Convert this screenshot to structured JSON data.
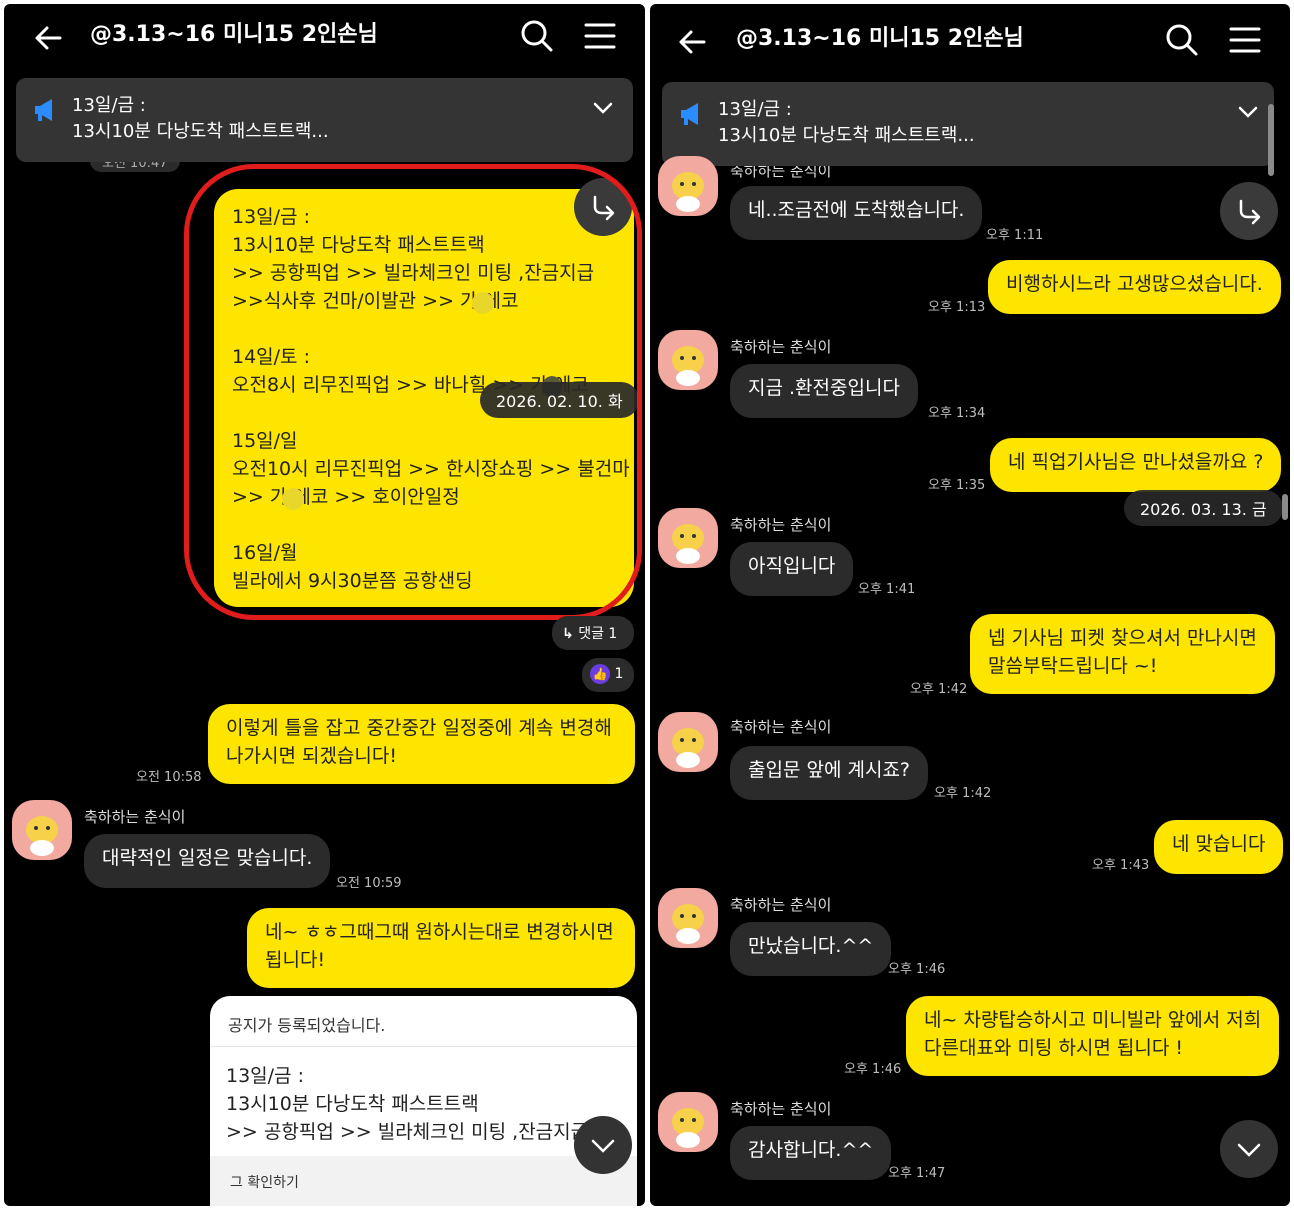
{
  "left": {
    "header": {
      "title": "@3.13~16 미니15 2인손님"
    },
    "notice": {
      "line1": "13일/금 :",
      "line2": "13시10분 다낭도착 패스트트랙..."
    },
    "top_partial_time": "오전 10:47",
    "schedule_message": {
      "lines": [
        "13일/금 :",
        "13시10분 다낭도착 패스트트랙",
        ">> 공항픽업 >> 빌라체크인 미팅 ,잔금지급",
        ">>식사후 건마/이발관 >> 가 에코",
        "",
        "14일/토 :",
        "오전8시 리무진픽업 >> 바나힐 >> 가 에코",
        "",
        "15일/일",
        "오전10시 리무진픽업 >> 한시장쇼핑 >> 불건마",
        ">> 가 에코 >> 호이안일정",
        "",
        "16일/월",
        "빌라에서 9시30분쯤 공항샌딩"
      ]
    },
    "date_chip": "2026. 02. 10. 화",
    "reply_pill": "댓글 1",
    "like_count": "1",
    "messages": [
      {
        "side": "me",
        "text1": "이렇게 틀을 잡고 중간중간 일정중에 계속 변경해",
        "text2": "나가시면 되겠습니다!",
        "time": "오전 10:58"
      },
      {
        "side": "other",
        "name": "축하하는 춘식이",
        "text1": "대략적인 일정은 맞습니다.",
        "time": "오전 10:59"
      },
      {
        "side": "me",
        "text1": "네~ ㅎㅎ그때그때 원하시는대로 변경하시면",
        "text2": "됩니다!"
      }
    ],
    "notice_card": {
      "head": "공지가 등록되었습니다.",
      "lines": [
        "13일/금 :",
        "13시10분 다낭도착 패스트트랙",
        ">> 공항픽업 >> 빌라체크인 미팅 ,잔금지급"
      ],
      "foot": "그 확인하기"
    }
  },
  "right": {
    "header": {
      "title": "@3.13~16 미니15 2인손님"
    },
    "notice": {
      "line1": "13일/금 :",
      "line2": "13시10분 다낭도착 패스트트랙..."
    },
    "top_partial_name": "축하하는 춘식이",
    "date_chip": "2026. 03. 13. 금",
    "messages": [
      {
        "side": "other",
        "text1": "네..조금전에 도착했습니다.",
        "time": "오후 1:11"
      },
      {
        "side": "me",
        "text1": "비행하시느라 고생많으셨습니다.",
        "time": "오후 1:13"
      },
      {
        "side": "other",
        "name": "축하하는 춘식이",
        "text1": "지금 .환전중입니다",
        "time": "오후 1:34"
      },
      {
        "side": "me",
        "text1": "네 픽업기사님은 만나셨을까요 ?",
        "time": "오후 1:35"
      },
      {
        "side": "other",
        "name": "축하하는 춘식이",
        "text1": "아직입니다",
        "time": "오후 1:41"
      },
      {
        "side": "me",
        "text1": "넵 기사님 피켓 찾으셔서 만나시면",
        "text2": "말씀부탁드립니다 ~!",
        "time": "오후 1:42"
      },
      {
        "side": "other",
        "name": "축하하는 춘식이",
        "text1": "출입문 앞에 계시죠?",
        "time": "오후 1:42"
      },
      {
        "side": "me",
        "text1": "네 맞습니다",
        "time": "오후 1:43"
      },
      {
        "side": "other",
        "name": "축하하는 춘식이",
        "text1": "만났습니다.^^",
        "time": "오후 1:46"
      },
      {
        "side": "me",
        "text1": "네~ 차량탑승하시고 미니빌라 앞에서 저희",
        "text2": "다른대표와 미팅 하시면 됩니다 !",
        "time": "오후 1:46"
      },
      {
        "side": "other",
        "name": "축하하는 춘식이",
        "text1": "감사합니다.^^",
        "time": "오후 1:47"
      }
    ]
  },
  "colors": {
    "bubble_me": "#fee500",
    "bubble_other": "#2b2b2b",
    "background": "#000000",
    "highlight_ring": "#e01c1c"
  },
  "icons": [
    "back-arrow-icon",
    "search-icon",
    "hamburger-menu-icon",
    "megaphone-icon",
    "chevron-down-icon",
    "share-arrow-icon",
    "reply-arrow-icon",
    "thumbs-up-icon",
    "avatar-character-icon"
  ]
}
